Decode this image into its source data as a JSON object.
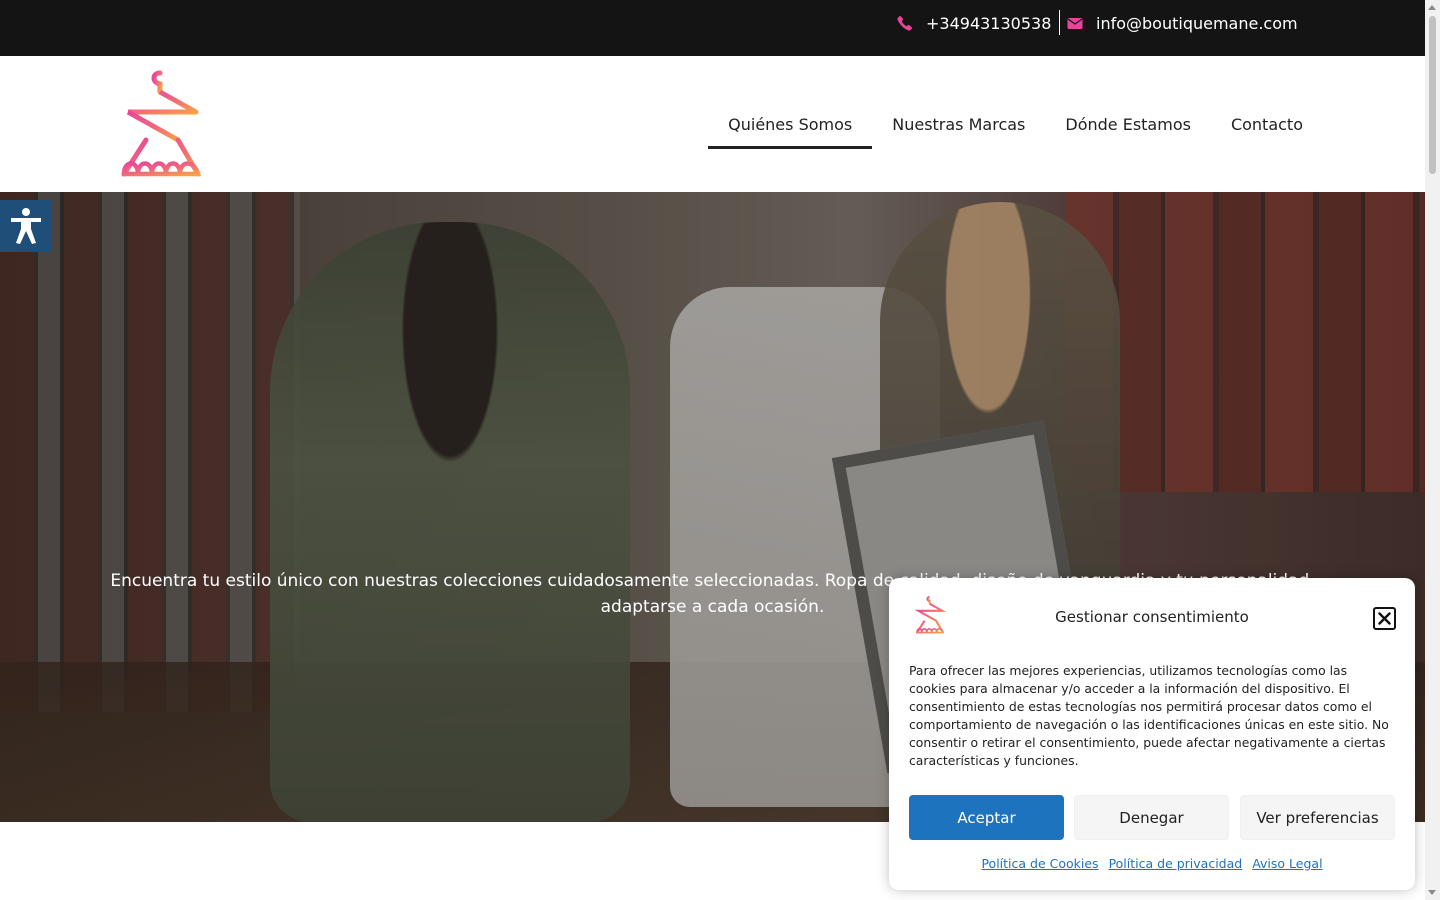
{
  "topbar": {
    "phone": "+34943130538",
    "email": "info@boutiquemane.com",
    "phone_icon": "phone-icon",
    "email_icon": "envelope-icon",
    "icon_color": "#e8459a"
  },
  "header": {
    "logo": "hanger-logo",
    "nav": [
      {
        "label": "Quiénes Somos",
        "active": true
      },
      {
        "label": "Nuestras Marcas",
        "active": false
      },
      {
        "label": "Dónde Estamos",
        "active": false
      },
      {
        "label": "Contacto",
        "active": false
      }
    ]
  },
  "hero": {
    "line1": "Encuentra tu estilo único con nuestras colecciones cuidadosamente seleccionadas. Ropa de calidad, diseño de vanguardia y tu personalidad,",
    "line2": "adaptarse a cada ocasión."
  },
  "accessibility": {
    "icon": "accessibility-icon",
    "color": "#1f4e79"
  },
  "cookie_dialog": {
    "title": "Gestionar consentimiento",
    "body": "Para ofrecer las mejores experiencias, utilizamos tecnologías como las cookies para almacenar y/o acceder a la información del dispositivo. El consentimiento de estas tecnologías nos permitirá procesar datos como el comportamiento de navegación o las identificaciones únicas en este sitio. No consentir o retirar el consentimiento, puede afectar negativamente a ciertas características y funciones.",
    "accept": "Aceptar",
    "deny": "Denegar",
    "preferences": "Ver preferencias",
    "links": [
      "Política de Cookies",
      "Política de privacidad",
      "Aviso Legal"
    ],
    "accent": "#1e73be"
  }
}
